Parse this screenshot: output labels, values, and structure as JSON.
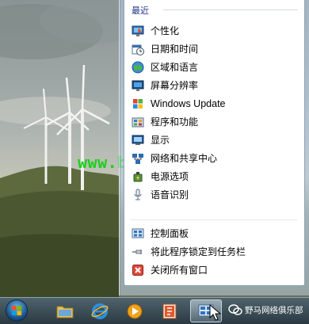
{
  "watermark": "www.bjdwx.com",
  "jumplist": {
    "recent_header": "最近",
    "recent_items": [
      {
        "label": "个性化",
        "icon": "personalization-icon"
      },
      {
        "label": "日期和时间",
        "icon": "date-time-icon"
      },
      {
        "label": "区域和语言",
        "icon": "region-language-icon"
      },
      {
        "label": "屏幕分辨率",
        "icon": "screen-resolution-icon"
      },
      {
        "label": "Windows Update",
        "icon": "windows-update-icon"
      },
      {
        "label": "程序和功能",
        "icon": "programs-features-icon"
      },
      {
        "label": "显示",
        "icon": "display-icon"
      },
      {
        "label": "网络和共享中心",
        "icon": "network-sharing-icon"
      },
      {
        "label": "电源选项",
        "icon": "power-options-icon"
      },
      {
        "label": "语音识别",
        "icon": "speech-recognition-icon"
      }
    ],
    "tasks": [
      {
        "label": "控制面板",
        "icon": "control-panel-icon"
      },
      {
        "label": "将此程序锁定到任务栏",
        "icon": "pin-icon"
      },
      {
        "label": "关闭所有窗口",
        "icon": "close-window-icon"
      }
    ]
  },
  "taskbar": {
    "wechat_badge": "野马网络俱乐部"
  }
}
